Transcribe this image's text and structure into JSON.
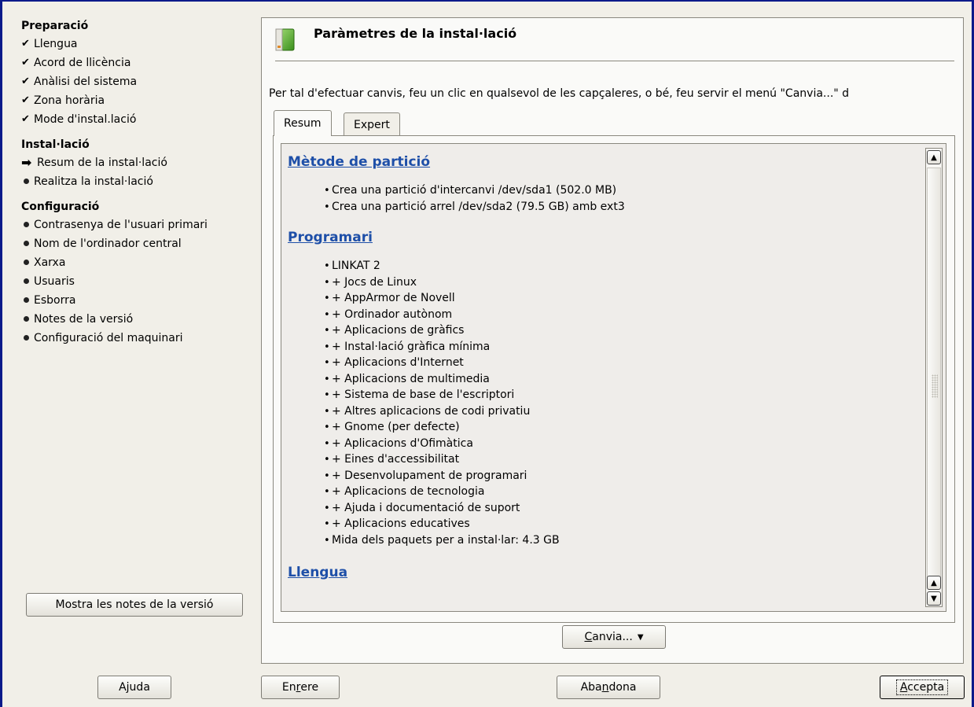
{
  "sidebar": {
    "sections": [
      {
        "title": "Preparació",
        "items": [
          {
            "label": "Llengua",
            "state": "done"
          },
          {
            "label": "Acord de llicència",
            "state": "done"
          },
          {
            "label": "Anàlisi del sistema",
            "state": "done"
          },
          {
            "label": "Zona horària",
            "state": "done"
          },
          {
            "label": "Mode d'instal.lació",
            "state": "done"
          }
        ]
      },
      {
        "title": "Instal·lació",
        "items": [
          {
            "label": "Resum de la instal·lació",
            "state": "current"
          },
          {
            "label": "Realitza la instal·lació",
            "state": "pending"
          }
        ]
      },
      {
        "title": "Configuració",
        "items": [
          {
            "label": "Contrasenya de l'usuari primari",
            "state": "pending"
          },
          {
            "label": "Nom de l'ordinador central",
            "state": "pending"
          },
          {
            "label": "Xarxa",
            "state": "pending"
          },
          {
            "label": "Usuaris",
            "state": "pending"
          },
          {
            "label": "Esborra",
            "state": "pending"
          },
          {
            "label": "Notes de la versió",
            "state": "pending"
          },
          {
            "label": "Configuració del maquinari",
            "state": "pending"
          }
        ]
      }
    ],
    "release_notes_button": "Mostra les notes de la versió"
  },
  "main": {
    "title": "Paràmetres de la instal·lació",
    "instructions": "Per tal d'efectuar canvis, feu un clic en qualsevol de les capçaleres, o bé, feu servir el menú \"Canvia...\" d",
    "tabs": [
      {
        "label": "Resum",
        "active": true
      },
      {
        "label": "Expert",
        "active": false
      }
    ],
    "partition": {
      "heading": "Mètode de partició",
      "items": [
        "Crea una partició d'intercanvi /dev/sda1 (502.0 MB)",
        "Crea una partició arrel /dev/sda2 (79.5 GB) amb ext3"
      ]
    },
    "software": {
      "heading": "Programari",
      "items": [
        "LINKAT 2",
        "+ Jocs de Linux",
        "+ AppArmor de Novell",
        "+ Ordinador autònom",
        "+ Aplicacions de gràfics",
        "+ Instal·lació gràfica mínima",
        "+ Aplicacions d'Internet",
        "+ Aplicacions de multimedia",
        "+ Sistema de base de l'escriptori",
        "+ Altres aplicacions de codi privatiu",
        "+ Gnome (per defecte)",
        "+ Aplicacions d'Ofimàtica",
        "+ Eines d'accessibilitat",
        "+ Desenvolupament de programari",
        "+ Aplicacions de tecnologia",
        "+ Ajuda i documentació de suport",
        "+ Aplicacions educatives",
        "Mida dels paquets per a instal·lar: 4.3 GB"
      ]
    },
    "language": {
      "heading": "Llengua"
    },
    "change_button": "Canvia...",
    "change_button_mnemonic": "C",
    "change_button_rest": "anvia..."
  },
  "footer": {
    "help": "Ajuda",
    "back_pre": "En",
    "back_mnemonic": "r",
    "back_post": "ere",
    "abort_pre": "Aba",
    "abort_mnemonic": "n",
    "abort_post": "dona",
    "accept_mnemonic": "A",
    "accept_post": "ccepta"
  },
  "colors": {
    "frame": "#0a1a8a",
    "heading_link": "#1e4fa8",
    "background": "#f1efe8"
  }
}
